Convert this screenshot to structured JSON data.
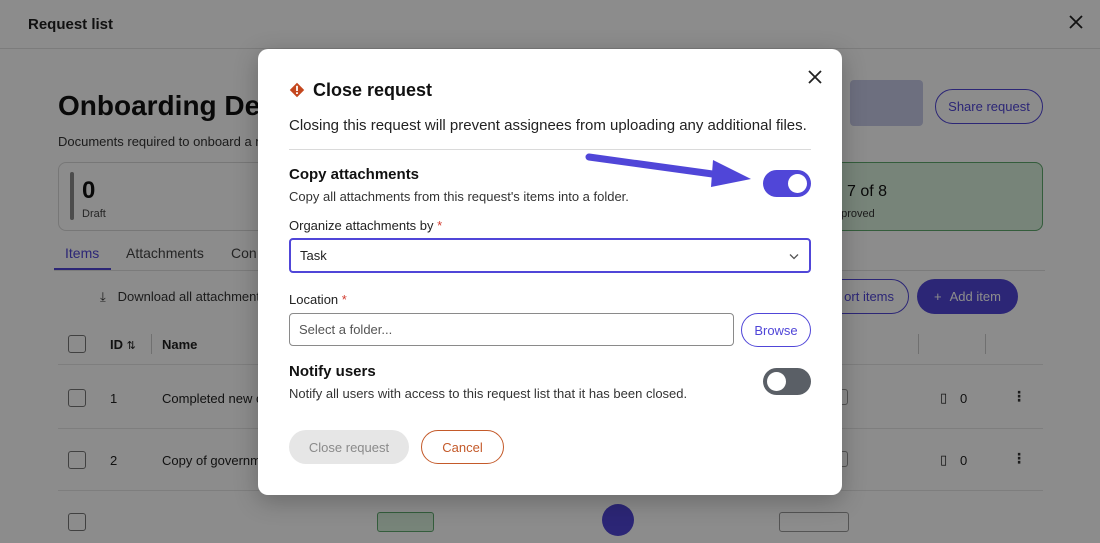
{
  "page": {
    "header_title": "Request list",
    "request_title": "Onboarding Det",
    "request_description": "Documents required to onboard a n",
    "share_label": "Share request",
    "stats": {
      "draft_count": "0",
      "draft_label": "Draft",
      "approved_count": "7",
      "approved_of": "of 8",
      "approved_label": "pproved"
    },
    "tabs": [
      "Items",
      "Attachments",
      "Con"
    ],
    "download_label": "Download all attachment",
    "import_label": "ort items",
    "add_item_label": "Add item",
    "columns": {
      "id": "ID",
      "name": "Name"
    },
    "rows": [
      {
        "id": "1",
        "name": "Completed new c",
        "attachments": "0"
      },
      {
        "id": "2",
        "name": "Copy of governm",
        "attachments": "0"
      }
    ]
  },
  "modal": {
    "title": "Close request",
    "description": "Closing this request will prevent assignees from uploading any additional files.",
    "copy_attachments": {
      "title": "Copy attachments",
      "text": "Copy all attachments from this request's items into a folder.",
      "enabled": true
    },
    "organize": {
      "label": "Organize attachments by",
      "required_mark": "*",
      "value": "Task"
    },
    "location": {
      "label": "Location",
      "required_mark": "*",
      "placeholder": "Select a folder...",
      "browse_label": "Browse"
    },
    "notify": {
      "title": "Notify users",
      "text": "Notify all users with access to this request list that it has been closed.",
      "enabled": false
    },
    "close_button_label": "Close request",
    "cancel_button_label": "Cancel"
  },
  "colors": {
    "accent": "#5046d8",
    "warning": "#c4471e",
    "cancel": "#c45a2a",
    "approved_bg": "#d9f1dd",
    "required": "#d13b2f"
  },
  "icons": [
    "close-icon",
    "warning-icon",
    "chevron-down-icon",
    "download-icon",
    "sort-icon",
    "plus-icon",
    "attachment-icon",
    "kebab-icon"
  ]
}
